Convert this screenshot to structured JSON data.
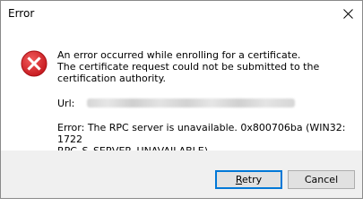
{
  "window": {
    "title": "Error",
    "close_icon": "close-icon"
  },
  "content": {
    "icon": "error-icon",
    "message_lines": [
      "An error occurred while enrolling for a certificate.",
      "The certificate request could not be submitted to the",
      "certification authority."
    ],
    "url_label": "Url:",
    "error_lines": [
      "Error: The RPC server is unavailable. 0x800706ba (WIN32: 1722",
      "RPC_S_SERVER_UNAVAILABLE)"
    ]
  },
  "buttons": {
    "retry_underlined_char": "R",
    "retry_rest": "etry",
    "cancel": "Cancel"
  },
  "colors": {
    "error_red": "#e81123",
    "focus_blue": "#0078d7",
    "footer_bg": "#f0f0f0"
  }
}
